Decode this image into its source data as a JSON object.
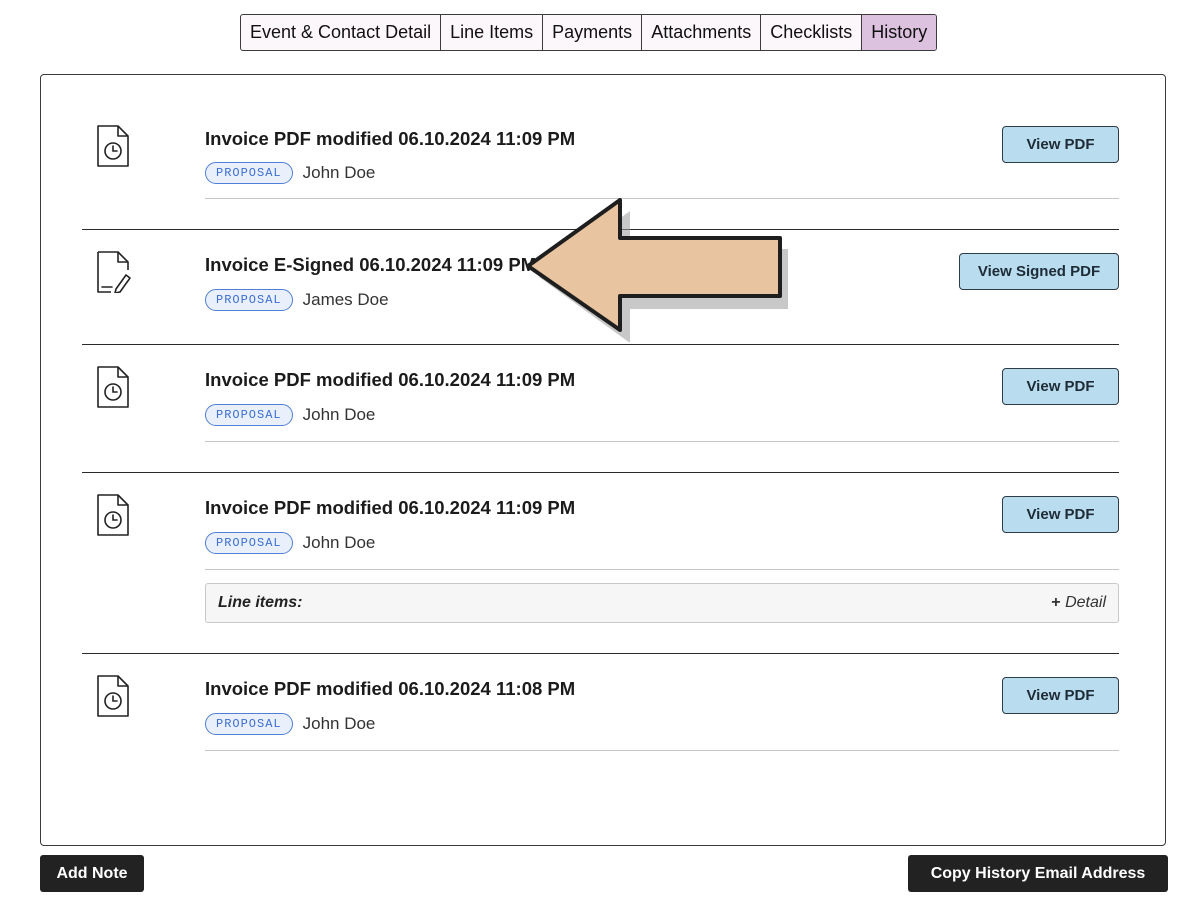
{
  "tabs": [
    {
      "label": "Event & Contact Detail",
      "active": false
    },
    {
      "label": "Line Items",
      "active": false
    },
    {
      "label": "Payments",
      "active": false
    },
    {
      "label": "Attachments",
      "active": false
    },
    {
      "label": "Checklists",
      "active": false
    },
    {
      "label": "History",
      "active": true
    }
  ],
  "history": [
    {
      "icon": "document-clock-icon",
      "title": "Invoice PDF modified 06.10.2024 11:09 PM",
      "badge": "PROPOSAL",
      "author": "John Doe",
      "button": "View PDF"
    },
    {
      "icon": "document-signature-icon",
      "title": "Invoice E-Signed 06.10.2024 11:09 PM",
      "badge": "PROPOSAL",
      "author": "James Doe",
      "button": "View Signed PDF"
    },
    {
      "icon": "document-clock-icon",
      "title": "Invoice PDF modified 06.10.2024 11:09 PM",
      "badge": "PROPOSAL",
      "author": "John Doe",
      "button": "View PDF"
    },
    {
      "icon": "document-clock-icon",
      "title": "Invoice PDF modified 06.10.2024 11:09 PM",
      "badge": "PROPOSAL",
      "author": "John Doe",
      "button": "View PDF",
      "detail": {
        "label": "Line items:",
        "toggle_symbol": "+",
        "toggle_label": "Detail"
      }
    },
    {
      "icon": "document-clock-icon",
      "title": "Invoice PDF modified 06.10.2024 11:08 PM",
      "badge": "PROPOSAL",
      "author": "John Doe",
      "button": "View PDF"
    }
  ],
  "footer": {
    "add_note_label": "Add Note",
    "copy_email_label": "Copy History Email Address"
  },
  "colors": {
    "active_tab": "#dcc2df",
    "view_button": "#b9dcee",
    "badge_border": "#4f7fd6",
    "callout_arrow": "#e8c4a0"
  }
}
